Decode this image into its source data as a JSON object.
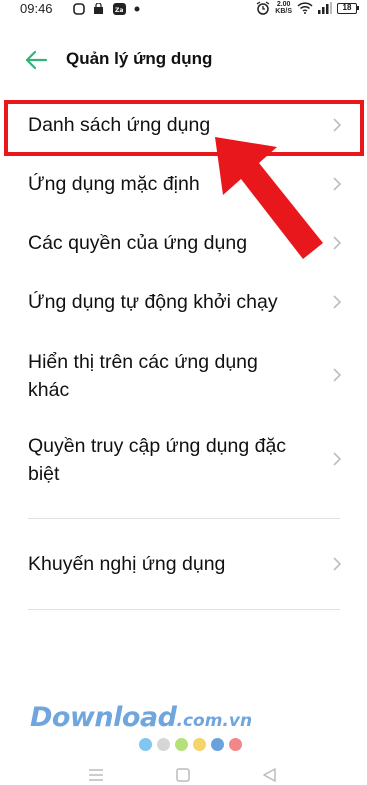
{
  "status_bar": {
    "time": "09:46",
    "net_speed": "2.00",
    "net_unit": "KB/S",
    "battery": "18",
    "icons": [
      "notification-app-icon",
      "shopping-bag-icon",
      "zalo-icon",
      "dot-icon",
      "alarm-icon",
      "wifi-icon",
      "signal-icon",
      "battery-icon"
    ]
  },
  "header": {
    "title": "Quản lý ứng dụng",
    "back_icon": "arrow-left-icon"
  },
  "menu": {
    "items": [
      {
        "label": "Danh sách ứng dụng"
      },
      {
        "label": "Ứng dụng mặc định"
      },
      {
        "label": "Các quyền của ứng dụng"
      },
      {
        "label": "Ứng dụng tự động khởi chạy"
      },
      {
        "label": "Hiển thị trên các ứng dụng khác"
      },
      {
        "label": "Quyền truy cập ứng dụng đặc biệt"
      }
    ],
    "secondary_items": [
      {
        "label": "Khuyến nghị ứng dụng"
      }
    ]
  },
  "annotation": {
    "highlight_color": "#e8171c",
    "arrow_color": "#e8171c"
  },
  "watermark": {
    "brand": "Download",
    "tld": ".com.vn",
    "dot_colors": [
      "#7fc6f2",
      "#d6d6d6",
      "#b6e07a",
      "#f5d46a",
      "#6aa2dd",
      "#f28787"
    ]
  },
  "nav_bar": {
    "icons": [
      "menu-icon",
      "home-icon",
      "back-icon"
    ]
  },
  "colors": {
    "accent": "#2fb37a",
    "chevron": "#bdbdbd"
  }
}
